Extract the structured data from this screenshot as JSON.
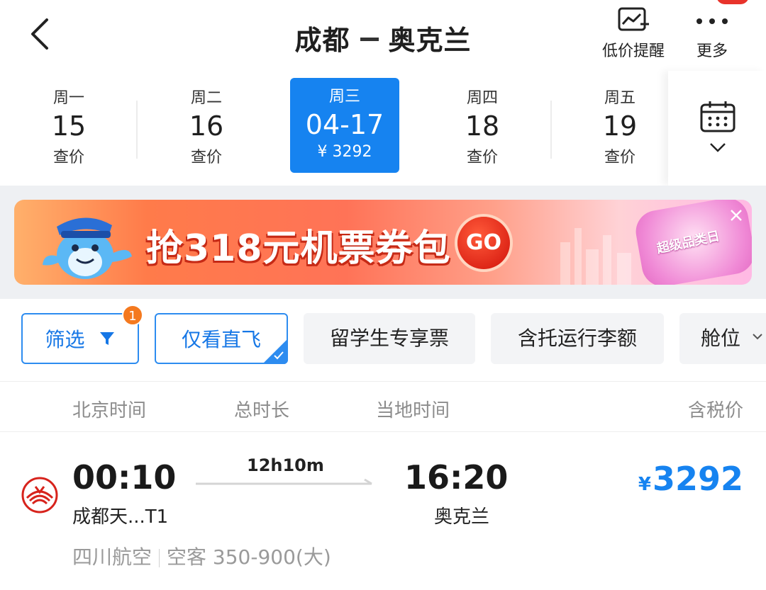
{
  "header": {
    "origin": "成都",
    "destination": "奥克兰",
    "alert_label": "低价提醒",
    "more_label": "更多"
  },
  "dates": [
    {
      "weekday": "周一",
      "date": "15",
      "price": "查价",
      "active": false
    },
    {
      "weekday": "周二",
      "date": "16",
      "price": "查价",
      "active": false
    },
    {
      "weekday": "周三",
      "date": "04-17",
      "price": "¥ 3292",
      "active": true
    },
    {
      "weekday": "周四",
      "date": "18",
      "price": "查价",
      "active": false
    },
    {
      "weekday": "周五",
      "date": "19",
      "price": "查价",
      "active": false
    }
  ],
  "banner": {
    "promo_text": "抢318元机票券包",
    "go_label": "GO",
    "badge_text": "超级品类日"
  },
  "filters": {
    "filter_label": "筛选",
    "filter_count": "1",
    "direct_label": "仅看直飞",
    "student_label": "留学生专享票",
    "baggage_label": "含托运行李额",
    "cabin_label": "舱位"
  },
  "columns": {
    "beijing_time": "北京时间",
    "duration": "总时长",
    "local_time": "当地时间",
    "tax_price": "含税价"
  },
  "flight": {
    "dep_time": "00:10",
    "dep_airport": "成都天...T1",
    "duration": "12h10m",
    "arr_time": "16:20",
    "arr_airport": "奥克兰",
    "currency": "¥",
    "price": "3292",
    "airline": "四川航空",
    "aircraft": "空客 350-900(大)"
  },
  "colors": {
    "accent": "#1683f0",
    "badge_orange": "#f4791f",
    "muted_text": "#8c8c8c"
  }
}
